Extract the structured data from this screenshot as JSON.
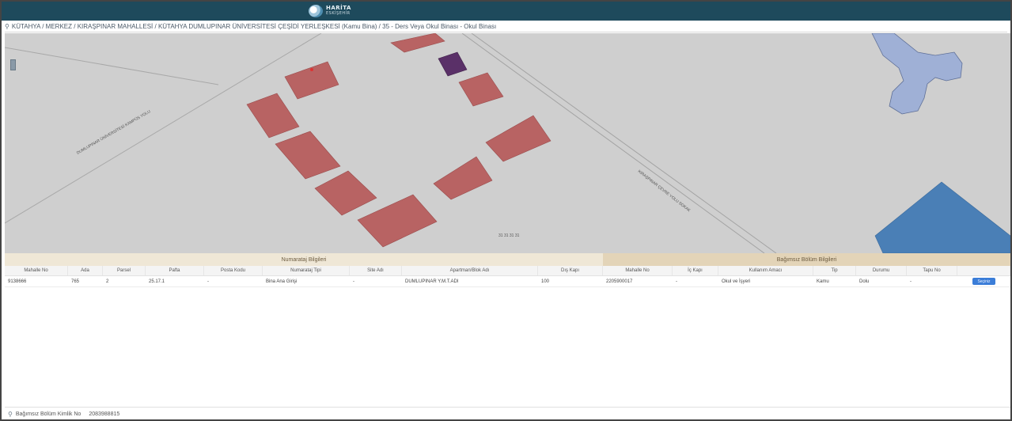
{
  "header": {
    "logo_title": "HARİTA",
    "logo_subtitle": "ESKİŞEHİR"
  },
  "breadcrumb": {
    "text": "KÜTAHYA / MERKEZ / KIRAŞPINAR MAHALLESİ / KÜTAHYA DUMLUPINAR ÜNİVERSİTESİ ÇEŞİDİ YERLEŞKESİ (Kamu Bina) / 35 - Ders Veya Okul Binası - Okul Binası"
  },
  "map": {
    "road_label_1": "DUMLUPINAR ÜNİVERSİTESİ KAMPÜS YOLU",
    "road_label_2": "KIRAŞPINAR ÇEVRE YOLU SOKAK",
    "center_label": "31 31 31 31",
    "colors": {
      "background": "#cfcfcf",
      "building": "#b86363",
      "building_selected": "#5a3068",
      "water": "#9fb0d6",
      "area_blue": "#4a7fb6"
    }
  },
  "panel": {
    "left_group_title": "Numarataj Bilgileri",
    "right_group_title": "Bağımsız Bölüm Bilgileri",
    "columns_left": [
      "Mahalle No",
      "Ada",
      "Parsel",
      "Pafta",
      "Posta Kodu",
      "Numarataj Tipi",
      "Site Adı",
      "Apartman/Blok Adı",
      "Dış Kapı"
    ],
    "columns_right": [
      "Mahalle No",
      "İç Kapı",
      "Kullanım Amacı",
      "Tip",
      "Durumu",
      "Tapu No",
      ""
    ],
    "row_left": [
      "9138666",
      "765",
      "2",
      "25.17.1",
      "-",
      "Bina Ana Girişi",
      "-",
      "DUMLUPINAR Y.M.T.ADI",
      "100"
    ],
    "row_right": [
      "2205900017",
      "-",
      "Okul ve İşyeri",
      "Kamu",
      "Dolu",
      "-"
    ],
    "action_label": "Seçiniz"
  },
  "footer": {
    "label": "Bağımsız Bölüm Kimlik No",
    "value": "2083988815"
  }
}
